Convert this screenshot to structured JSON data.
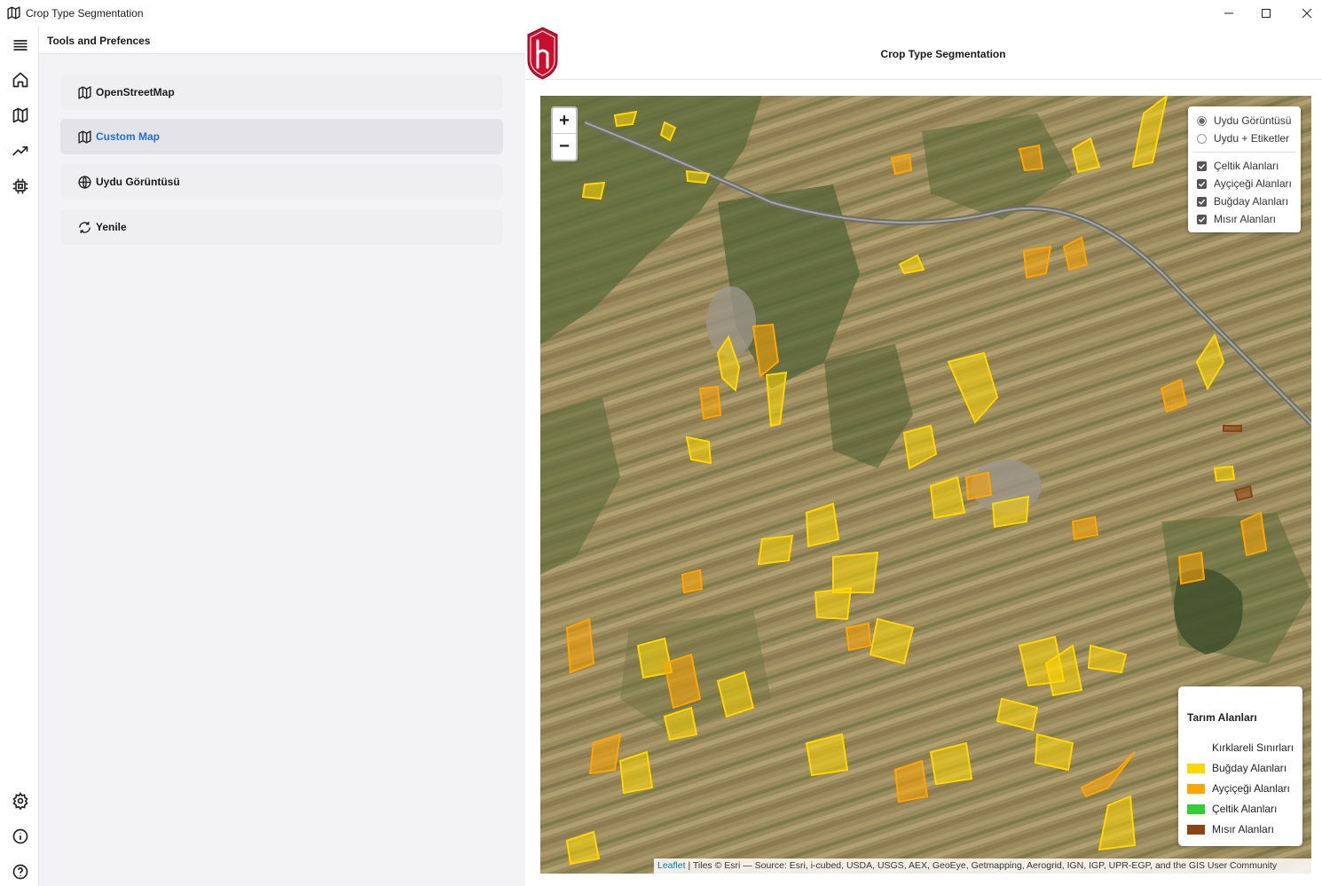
{
  "window": {
    "title": "Crop Type Segmentation",
    "controls": [
      "minimize",
      "maximize",
      "close"
    ]
  },
  "rail": {
    "items": [
      "menu-icon",
      "home-icon",
      "map-icon",
      "trending-icon",
      "chip-icon"
    ],
    "bottom_items": [
      "settings-icon",
      "info-icon",
      "help-icon"
    ]
  },
  "tools": {
    "header": "Tools and Prefences",
    "items": [
      {
        "label": "OpenStreetMap",
        "icon": "map-icon",
        "active": false
      },
      {
        "label": "Custom Map",
        "icon": "map-icon",
        "active": true
      },
      {
        "label": "Uydu Görüntüsü",
        "icon": "globe-icon",
        "active": false
      },
      {
        "label": "Yenile",
        "icon": "refresh-icon",
        "active": false
      }
    ]
  },
  "main": {
    "title": "Crop Type Segmentation"
  },
  "map": {
    "zoom_in": "+",
    "zoom_out": "−",
    "base_layers": [
      {
        "label": "Uydu Görüntüsü",
        "selected": true
      },
      {
        "label": "Uydu + Etiketler",
        "selected": false
      }
    ],
    "overlays": [
      {
        "label": "Çeltik Alanları",
        "checked": true
      },
      {
        "label": "Ayçiçeği Alanları",
        "checked": true
      },
      {
        "label": "Buğday Alanları",
        "checked": true
      },
      {
        "label": "Mısır Alanları",
        "checked": true
      }
    ],
    "legend": {
      "title": "Tarım Alanları",
      "items": [
        {
          "label": "Kırklareli Sınırları",
          "color": ""
        },
        {
          "label": "Buğday Alanları",
          "color": "#ffd700"
        },
        {
          "label": "Ayçiçeği Alanları",
          "color": "#ffa500"
        },
        {
          "label": "Çeltik Alanları",
          "color": "#32cd32"
        },
        {
          "label": "Mısır Alanları",
          "color": "#8b4513"
        }
      ]
    },
    "attribution_link": "Leaflet",
    "attribution_text": " | Tiles © Esri — Source: Esri, i-cubed, USDA, USGS, AEX, GeoEye, Getmapping, Aerogrid, IGN, IGP, UPR-EGP, and the GIS User Community"
  }
}
